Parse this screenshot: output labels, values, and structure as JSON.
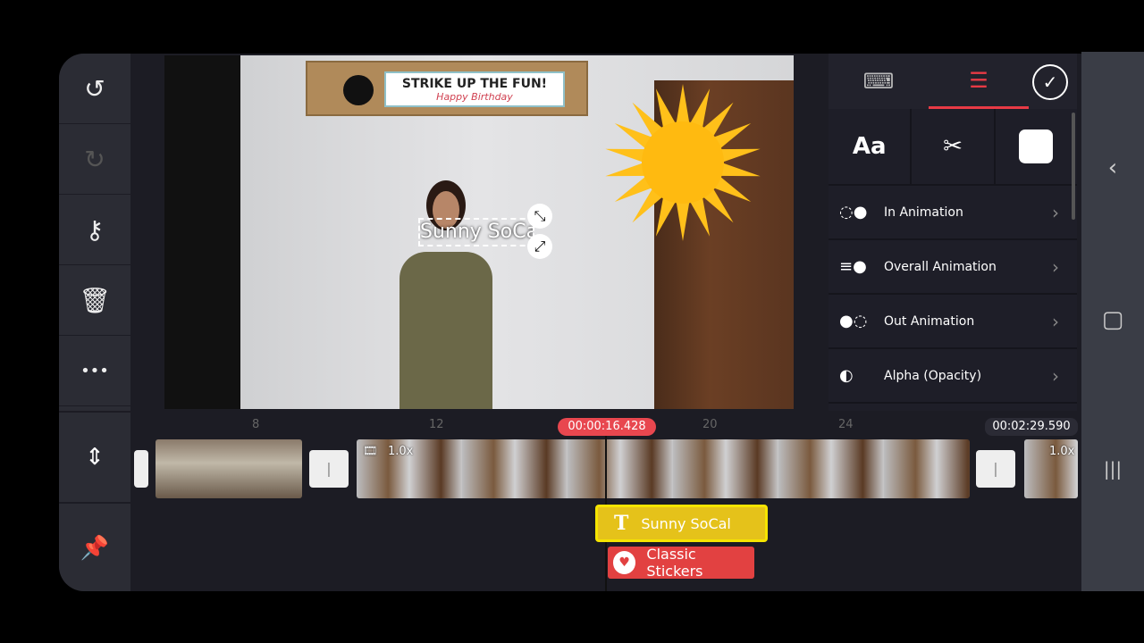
{
  "left_toolbar": {
    "items": [
      {
        "icon": "undo-icon",
        "glyph": "↺"
      },
      {
        "icon": "redo-icon",
        "glyph": "↻"
      },
      {
        "icon": "key-icon",
        "glyph": "⚷"
      },
      {
        "icon": "trash-icon",
        "glyph": "🗑"
      },
      {
        "icon": "more-icon",
        "glyph": "•••"
      }
    ]
  },
  "preview": {
    "banner_title": "STRIKE UP THE FUN!",
    "banner_subtitle": "Happy Birthday",
    "text_layer": "Sunny SoCal"
  },
  "right_panel": {
    "tabs": [
      {
        "icon": "keyboard-icon",
        "glyph": "⌨"
      },
      {
        "icon": "checklist-icon",
        "glyph": "☰",
        "active": true
      }
    ],
    "confirm_glyph": "✓",
    "tools": [
      {
        "label": "Aa"
      },
      {
        "icon": "scissors-icon",
        "glyph": "✂"
      },
      {
        "icon": "color-swatch",
        "color": "#ffffff"
      }
    ],
    "rows": [
      {
        "label": "In Animation",
        "icon": "in-animation-icon",
        "glyph": "◌●"
      },
      {
        "label": "Overall Animation",
        "icon": "overall-animation-icon",
        "glyph": "≡●"
      },
      {
        "label": "Out Animation",
        "icon": "out-animation-icon",
        "glyph": "●◌"
      },
      {
        "label": "Alpha (Opacity)",
        "icon": "alpha-icon",
        "glyph": "◐"
      }
    ]
  },
  "timeline": {
    "ruler_ticks": [
      "8",
      "12",
      "20",
      "24"
    ],
    "playhead_time": "00:00:16.428",
    "total_time": "00:02:29.590",
    "speed_label": "1.0x",
    "text_clip": "Sunny SoCal",
    "sticker_clip": "Classic Stickers",
    "accent": "#e8474f",
    "text_clip_color": "#e5c21a",
    "sticker_color": "#e24141"
  },
  "timeline_buttons": [
    {
      "icon": "split-view-icon",
      "glyph": "⇕"
    },
    {
      "icon": "pin-icon",
      "glyph": "📌"
    }
  ],
  "nav": {
    "back": "‹",
    "home": "▢",
    "recents": "|||"
  }
}
